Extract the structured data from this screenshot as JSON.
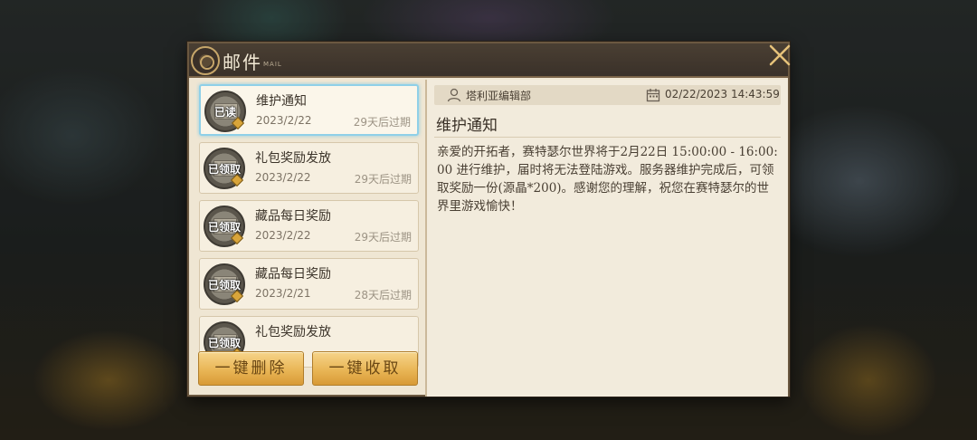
{
  "window": {
    "title": "邮件",
    "subtitle": "MAIL"
  },
  "mail_list": [
    {
      "title": "维护通知",
      "date": "2023/2/22",
      "expire": "29天后过期",
      "status": "已读",
      "selected": true
    },
    {
      "title": "礼包奖励发放",
      "date": "2023/2/22",
      "expire": "29天后过期",
      "status": "已领取",
      "selected": false
    },
    {
      "title": "藏品每日奖励",
      "date": "2023/2/22",
      "expire": "29天后过期",
      "status": "已领取",
      "selected": false
    },
    {
      "title": "藏品每日奖励",
      "date": "2023/2/21",
      "expire": "28天后过期",
      "status": "已领取",
      "selected": false
    },
    {
      "title": "礼包奖励发放",
      "date": "",
      "expire": "",
      "status": "已领取",
      "selected": false
    }
  ],
  "actions": {
    "delete_all": "一键删除",
    "collect_all": "一键收取"
  },
  "detail": {
    "sender": "塔利亚编辑部",
    "timestamp": "02/22/2023 14:43:59",
    "title": "维护通知",
    "body": "亲爱的开拓者，赛特瑟尔世界将于2月22日 15:00:00 - 16:00:00 进行维护，届时将无法登陆游戏。服务器维护完成后，可领取奖励一份(源晶*200)。感谢您的理解，祝您在赛特瑟尔的世界里游戏愉快！"
  },
  "colors": {
    "accent_gold": "#e9b656",
    "selected_border": "#8fd0e8",
    "panel_bg": "#efe6d3"
  }
}
